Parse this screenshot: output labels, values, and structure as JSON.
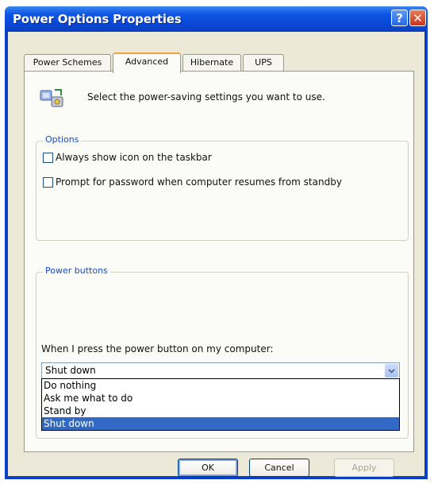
{
  "window": {
    "title": "Power Options Properties",
    "help_label": "?",
    "close_label": "✕"
  },
  "tabs": [
    {
      "label": "Power Schemes"
    },
    {
      "label": "Advanced"
    },
    {
      "label": "Hibernate"
    },
    {
      "label": "UPS"
    }
  ],
  "active_tab": "Advanced",
  "header": {
    "text": "Select the power-saving settings you want to use.",
    "icon": "power-settings-icon"
  },
  "options": {
    "label": "Options",
    "checkboxes": [
      {
        "label": "Always show icon on the taskbar",
        "checked": false
      },
      {
        "label": "Prompt for password when computer resumes from standby",
        "checked": false
      }
    ]
  },
  "power_buttons": {
    "label": "Power buttons",
    "prompt": "When I press the power button on my computer:",
    "selected": "Shut down",
    "options": [
      "Do nothing",
      "Ask me what to do",
      "Stand by",
      "Shut down"
    ]
  },
  "buttons": {
    "ok": "OK",
    "cancel": "Cancel",
    "apply": "Apply"
  },
  "colors": {
    "title_bar": "#0a47d6",
    "selection": "#316ac5",
    "group_label": "#1a4bd1",
    "active_tab_accent": "#f2a23c"
  }
}
